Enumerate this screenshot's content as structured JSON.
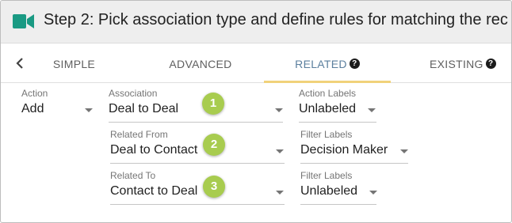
{
  "header": {
    "icon": "video-camera-icon",
    "icon_color": "#1a9a83",
    "title": "Step 2: Pick association type and define rules for matching the rec"
  },
  "tabs": {
    "back_icon": "chevron-left-icon",
    "items": [
      {
        "label": "SIMPLE",
        "active": false,
        "help": false
      },
      {
        "label": "ADVANCED",
        "active": false,
        "help": false
      },
      {
        "label": "RELATED",
        "active": true,
        "help": true
      },
      {
        "label": "EXISTING",
        "active": false,
        "help": true
      }
    ],
    "help_glyph": "?",
    "active_color": "#5b7f9e",
    "underline_color": "#f1d27a"
  },
  "form": {
    "action": {
      "label": "Action",
      "value": "Add"
    },
    "association": {
      "label": "Association",
      "value": "Deal to Deal"
    },
    "action_labels": {
      "label": "Action Labels",
      "value": "Unlabeled"
    },
    "related_from": {
      "label": "Related From",
      "value": "Deal to Contact"
    },
    "filter_labels_1": {
      "label": "Filter Labels",
      "value": "Decision Maker"
    },
    "related_to": {
      "label": "Related To",
      "value": "Contact to Deal"
    },
    "filter_labels_2": {
      "label": "Filter Labels",
      "value": "Unlabeled"
    }
  },
  "badges": {
    "color": "#a8cc4f",
    "items": [
      "1",
      "2",
      "3"
    ]
  }
}
